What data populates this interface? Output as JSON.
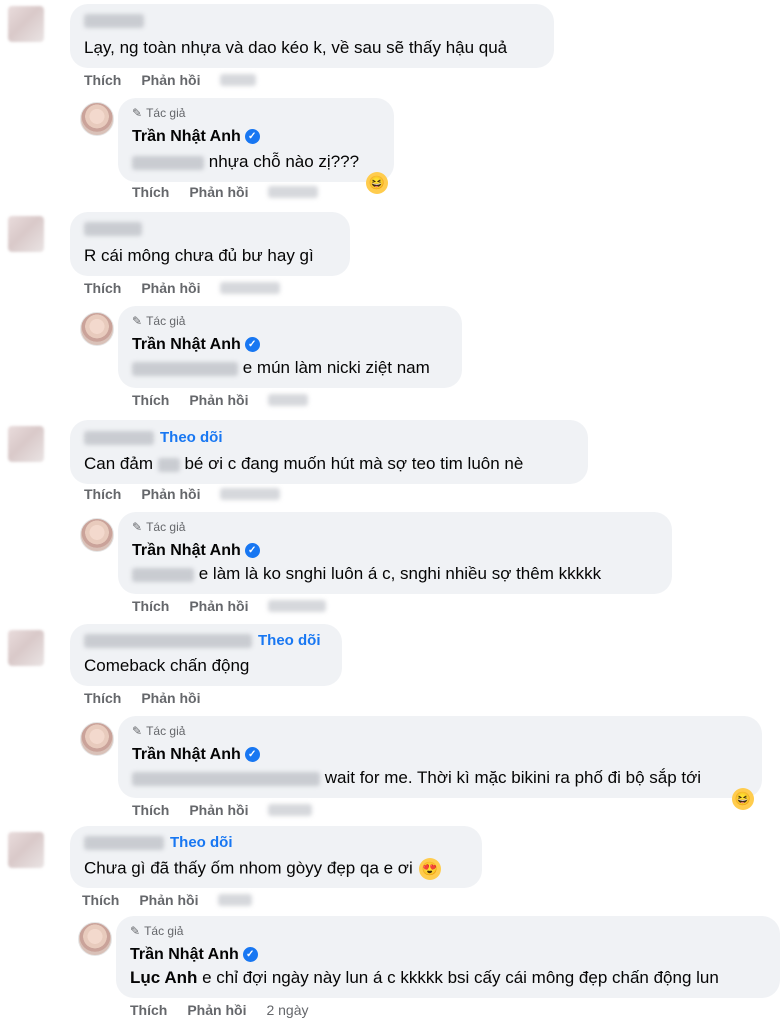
{
  "labels": {
    "like": "Thích",
    "reply": "Phản hồi",
    "author_tag": "Tác giả",
    "follow": "Theo dõi",
    "author_name": "Trần Nhật Anh"
  },
  "icons": {
    "verified": "verified-badge-icon",
    "pencil": "pencil-icon",
    "laugh": "laughing-emoji-icon",
    "heart_eyes": "heart-eyes-emoji-icon"
  },
  "colors": {
    "accent": "#1877f2",
    "bubble": "#f0f2f5",
    "meta": "#65676b"
  },
  "comments": [
    {
      "text": "Lạy, ng toàn nhựa và dao kéo k, về sau sẽ thấy hậu quả"
    },
    {
      "text": "nhựa chỗ nào zị???"
    },
    {
      "text": "R cái mông chưa đủ bư hay gì"
    },
    {
      "text": "e mún làm nicki ziệt nam"
    },
    {
      "text": "Can đảm ",
      "text2": "bé ơi c đang muốn hút mà sợ teo tim luôn nè"
    },
    {
      "text": "e làm là ko snghi luôn á c, snghi nhiều sợ thêm kkkkk"
    },
    {
      "text": "Comeback chấn động"
    },
    {
      "text": "wait for me. Thời kì mặc bikini ra phố đi bộ sắp tới"
    },
    {
      "text": "Chưa gì đã thấy ốm nhom gòyy đẹp qa e ơi"
    },
    {
      "mention": "Lục Anh",
      "text": " e chỉ đợi ngày này lun á c kkkkk bsi cấy cái mông đẹp chấn động lun",
      "time": "2 ngày"
    }
  ]
}
